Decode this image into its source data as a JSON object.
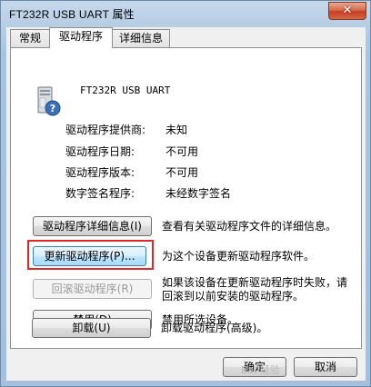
{
  "window": {
    "title": "FT232R USB UART 属性",
    "close_glyph": "✕"
  },
  "tabs": [
    {
      "label": "常规"
    },
    {
      "label": "驱动程序"
    },
    {
      "label": "详细信息"
    }
  ],
  "device": {
    "name": "FT232R USB UART",
    "icon": "usb-device-unknown-icon"
  },
  "properties": [
    {
      "label": "驱动程序提供商:",
      "value": "未知"
    },
    {
      "label": "驱动程序日期:",
      "value": "不可用"
    },
    {
      "label": "驱动程序版本:",
      "value": "不可用"
    },
    {
      "label": "数字签名程序:",
      "value": "未经数字签名"
    }
  ],
  "actions": {
    "details": {
      "label": "驱动程序详细信息(I)",
      "desc": "查看有关驱动程序文件的详细信息。"
    },
    "update": {
      "label": "更新驱动程序(P)...",
      "desc": "为这个设备更新驱动程序软件。"
    },
    "rollback": {
      "label": "回滚驱动程序(R)",
      "desc_line1": "如果该设备在更新驱动程序时失败，请",
      "desc_line2": "回滚到以前安装的驱动程序。"
    },
    "disable": {
      "label": "禁用(D)",
      "desc": "禁用所选设备。"
    },
    "uninstall": {
      "label": "卸载(U)",
      "desc": "卸载驱动程序(高级)。"
    }
  },
  "footer": {
    "ok": "确定",
    "cancel": "取消"
  },
  "highlight_color": "#e0282a",
  "watermark": "Bai·经验"
}
